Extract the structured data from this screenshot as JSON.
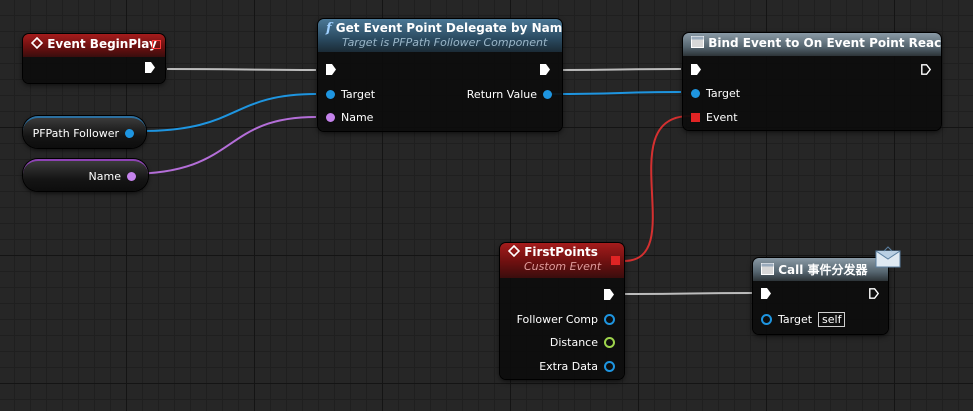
{
  "nodes": {
    "event_begin_play": {
      "title": "Event BeginPlay"
    },
    "get_delegate": {
      "title": "Get Event Point Delegate by Name",
      "subtitle": "Target is PFPath Follower Component",
      "pins": {
        "target": "Target",
        "name": "Name",
        "return_value": "Return Value"
      }
    },
    "bind_event": {
      "title": "Bind Event to On Event Point Reached",
      "pins": {
        "target": "Target",
        "event": "Event"
      }
    },
    "var_pfpath": {
      "label": "PFPath Follower"
    },
    "var_name": {
      "label": "Name"
    },
    "first_points": {
      "title": "FirstPoints",
      "subtitle": "Custom Event",
      "pins": {
        "follower_comp": "Follower Comp",
        "distance": "Distance",
        "extra_data": "Extra Data"
      }
    },
    "call_dispatcher": {
      "title": "Call 事件分发器",
      "pins": {
        "target": "Target",
        "self": "self"
      }
    }
  },
  "colors": {
    "exec_wire": "#c8c8c8",
    "object_pin": "#1e95e0",
    "name_pin": "#c583ec",
    "float_pin": "#9ed44c",
    "delegate_pin": "#e02424",
    "event_header": "#a51c1c",
    "function_header": "#4b7896"
  },
  "icons": {
    "event": "event-diamond-icon",
    "function": "function-f-icon",
    "bind": "delegate-node-icon",
    "message": "envelope-icon"
  }
}
